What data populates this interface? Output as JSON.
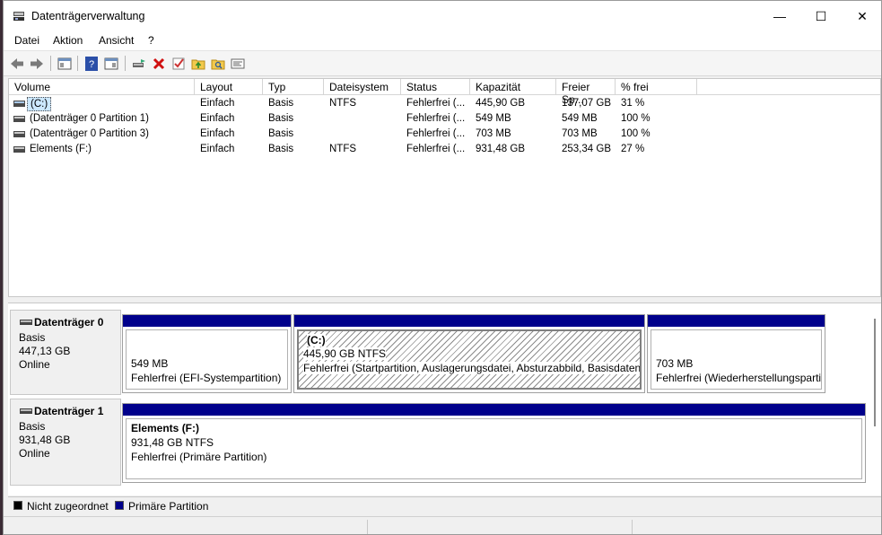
{
  "window": {
    "title": "Datenträgerverwaltung",
    "minimize_glyph": "—",
    "maximize_glyph": "☐",
    "close_glyph": "✕"
  },
  "menu": [
    "Datei",
    "Aktion",
    "Ansicht",
    "?"
  ],
  "toolbar_icons": [
    "back-icon",
    "forward-icon",
    "console-tree-icon",
    "help-icon",
    "properties-icon",
    "connect-drive-icon",
    "delete-icon",
    "check-icon",
    "folder-up-icon",
    "folder-search-icon",
    "settings-list-icon"
  ],
  "list": {
    "columns": [
      "Volume",
      "Layout",
      "Typ",
      "Dateisystem",
      "Status",
      "Kapazität",
      "Freier Sp...",
      "% frei"
    ],
    "rows": [
      {
        "volume": "(C:)",
        "layout": "Einfach",
        "typ": "Basis",
        "fs": "NTFS",
        "status": "Fehlerfrei (...",
        "capacity": "445,90 GB",
        "free": "137,07 GB",
        "pct": "31 %",
        "selected": true
      },
      {
        "volume": "(Datenträger 0 Partition 1)",
        "layout": "Einfach",
        "typ": "Basis",
        "fs": "",
        "status": "Fehlerfrei (...",
        "capacity": "549 MB",
        "free": "549 MB",
        "pct": "100 %",
        "selected": false
      },
      {
        "volume": "(Datenträger 0 Partition 3)",
        "layout": "Einfach",
        "typ": "Basis",
        "fs": "",
        "status": "Fehlerfrei (...",
        "capacity": "703 MB",
        "free": "703 MB",
        "pct": "100 %",
        "selected": false
      },
      {
        "volume": "Elements (F:)",
        "layout": "Einfach",
        "typ": "Basis",
        "fs": "NTFS",
        "status": "Fehlerfrei (...",
        "capacity": "931,48 GB",
        "free": "253,34 GB",
        "pct": "27 %",
        "selected": false
      }
    ]
  },
  "disks": [
    {
      "name": "Datenträger 0",
      "type": "Basis",
      "size": "447,13 GB",
      "state": "Online",
      "partitions": [
        {
          "title": "",
          "size": "549 MB",
          "status": "Fehlerfrei (EFI-Systempartition)"
        },
        {
          "title": "(C:)",
          "size": "445,90 GB NTFS",
          "status": "Fehlerfrei (Startpartition, Auslagerungsdatei, Absturzabbild, Basisdatenp"
        },
        {
          "title": "",
          "size": "703 MB",
          "status": "Fehlerfrei (Wiederherstellungsparti"
        }
      ]
    },
    {
      "name": "Datenträger 1",
      "type": "Basis",
      "size": "931,48 GB",
      "state": "Online",
      "partitions": [
        {
          "title": "Elements  (F:)",
          "size": "931,48 GB NTFS",
          "status": "Fehlerfrei (Primäre Partition)"
        }
      ]
    }
  ],
  "legend": [
    {
      "label": "Nicht zugeordnet",
      "color": "#000000"
    },
    {
      "label": "Primäre Partition",
      "color": "#00008b"
    }
  ],
  "colors": {
    "primary_partition": "#00008b",
    "selection": "#cce8ff"
  }
}
